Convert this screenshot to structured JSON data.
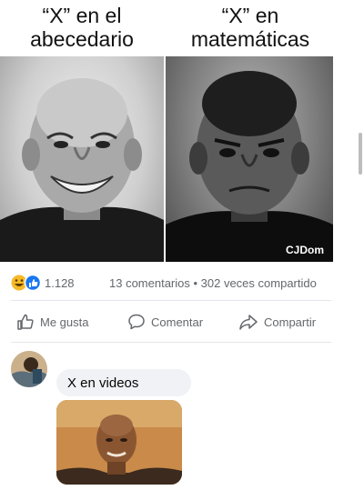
{
  "meme": {
    "left_caption_line1": "“X” en el",
    "left_caption_line2": "abecedario",
    "right_caption_line1": "“X” en",
    "right_caption_line2": "matemáticas",
    "watermark": "CJDom"
  },
  "post": {
    "reaction_count": "1.128",
    "stats": "13 comentarios • 302 veces compartido",
    "actions": {
      "like_label": "Me gusta",
      "comment_label": "Comentar",
      "share_label": "Compartir"
    }
  },
  "comment": {
    "text": "X en videos"
  },
  "colors": {
    "meta_text": "#65676b",
    "like_blue": "#1877f2",
    "haha_yellow": "#f7b928",
    "bubble_bg": "#f0f2f5"
  }
}
